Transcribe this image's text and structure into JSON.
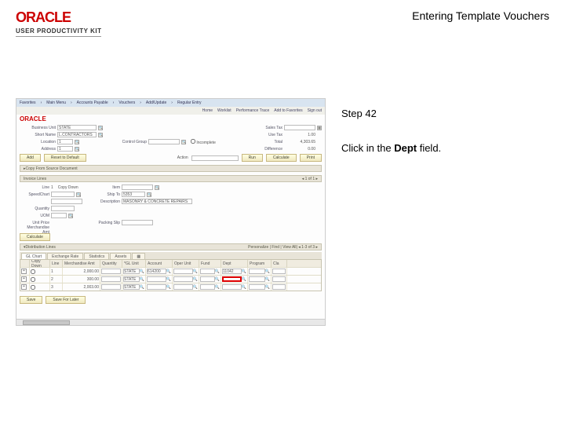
{
  "header": {
    "brand": "ORACLE",
    "product": "USER PRODUCTIVITY KIT",
    "title": "Entering Template Vouchers"
  },
  "panel": {
    "step": "Step 42",
    "instruction_prefix": "Click in the ",
    "instruction_bold": "Dept",
    "instruction_suffix": " field."
  },
  "ss": {
    "menubar": [
      "Favorites",
      "Main Menu",
      "Accounts Payable",
      "Vouchers",
      "Add/Update",
      "Regular Entry"
    ],
    "topnav": [
      "Home",
      "Worklist",
      "Performance Trace",
      "Add to Favorites",
      "Sign out"
    ],
    "oracle": "ORACLE",
    "fields": {
      "bu_lbl": "Business Unit",
      "bu_val": "STATE",
      "shortname_lbl": "Short Name",
      "shortname_val": "L.CONTRACTORS",
      "location_lbl": "Location",
      "location_val": "1",
      "address_lbl": "Address",
      "address_val": "1",
      "control_lbl": "Control Group",
      "incomplete_lbl": "Incomplete",
      "salestax_lbl": "Sales Tax",
      "usetax_lbl": "Use Tax",
      "usetax_val": "1.00",
      "total_lbl": "Total",
      "total_val": "4,303.65",
      "difference_lbl": "Difference",
      "difference_val": "0.00"
    },
    "btns": {
      "add": "Add",
      "reset": "Reset to Default",
      "action_lbl": "Action",
      "run": "Run",
      "calculate": "Calculate",
      "print": "Print"
    },
    "subhead1": "Copy From Source Document",
    "invoice_lines": "Invoice Lines",
    "line_section": {
      "line_lbl": "Line",
      "line_val": "1",
      "copydown_lbl": "Copy Down",
      "item_lbl": "Item",
      "speedchart_lbl": "SpeedChart",
      "shipto_lbl": "Ship To",
      "shipto_val": "5353",
      "desc_lbl": "Description",
      "desc_val": "MASONRY & CONCRETE REPAIRS",
      "quantity_lbl": "Quantity",
      "uom_lbl": "UOM",
      "packslip_lbl": "Packing Slip",
      "price_lbl": "Unit Price",
      "merch_lbl": "Merchandise Amt",
      "calculate": "Calculate"
    },
    "dist_header": "Distribution Lines",
    "dist_nav": "Personalize | Find | View All",
    "tabs": [
      "GL Chart",
      "Exchange Rate",
      "Statistics",
      "Assets"
    ],
    "table_headers": [
      "",
      "Copy Down",
      "Line",
      "Merchandise Amt",
      "Quantity",
      "*GL Unit",
      "Account",
      "Oper Unit",
      "Fund",
      "Dept",
      "Program",
      "Cla"
    ],
    "rows": [
      {
        "line": "1",
        "amt": "2,000.00",
        "unit": "STATE",
        "acct": "614200",
        "dept": "11042"
      },
      {
        "line": "2",
        "amt": "300.00",
        "unit": "STATE",
        "acct": ""
      },
      {
        "line": "3",
        "amt": "2,003.00",
        "unit": "STATE",
        "acct": ""
      }
    ],
    "footer_btns": {
      "save": "Save",
      "save_later": "Save For Later"
    }
  }
}
